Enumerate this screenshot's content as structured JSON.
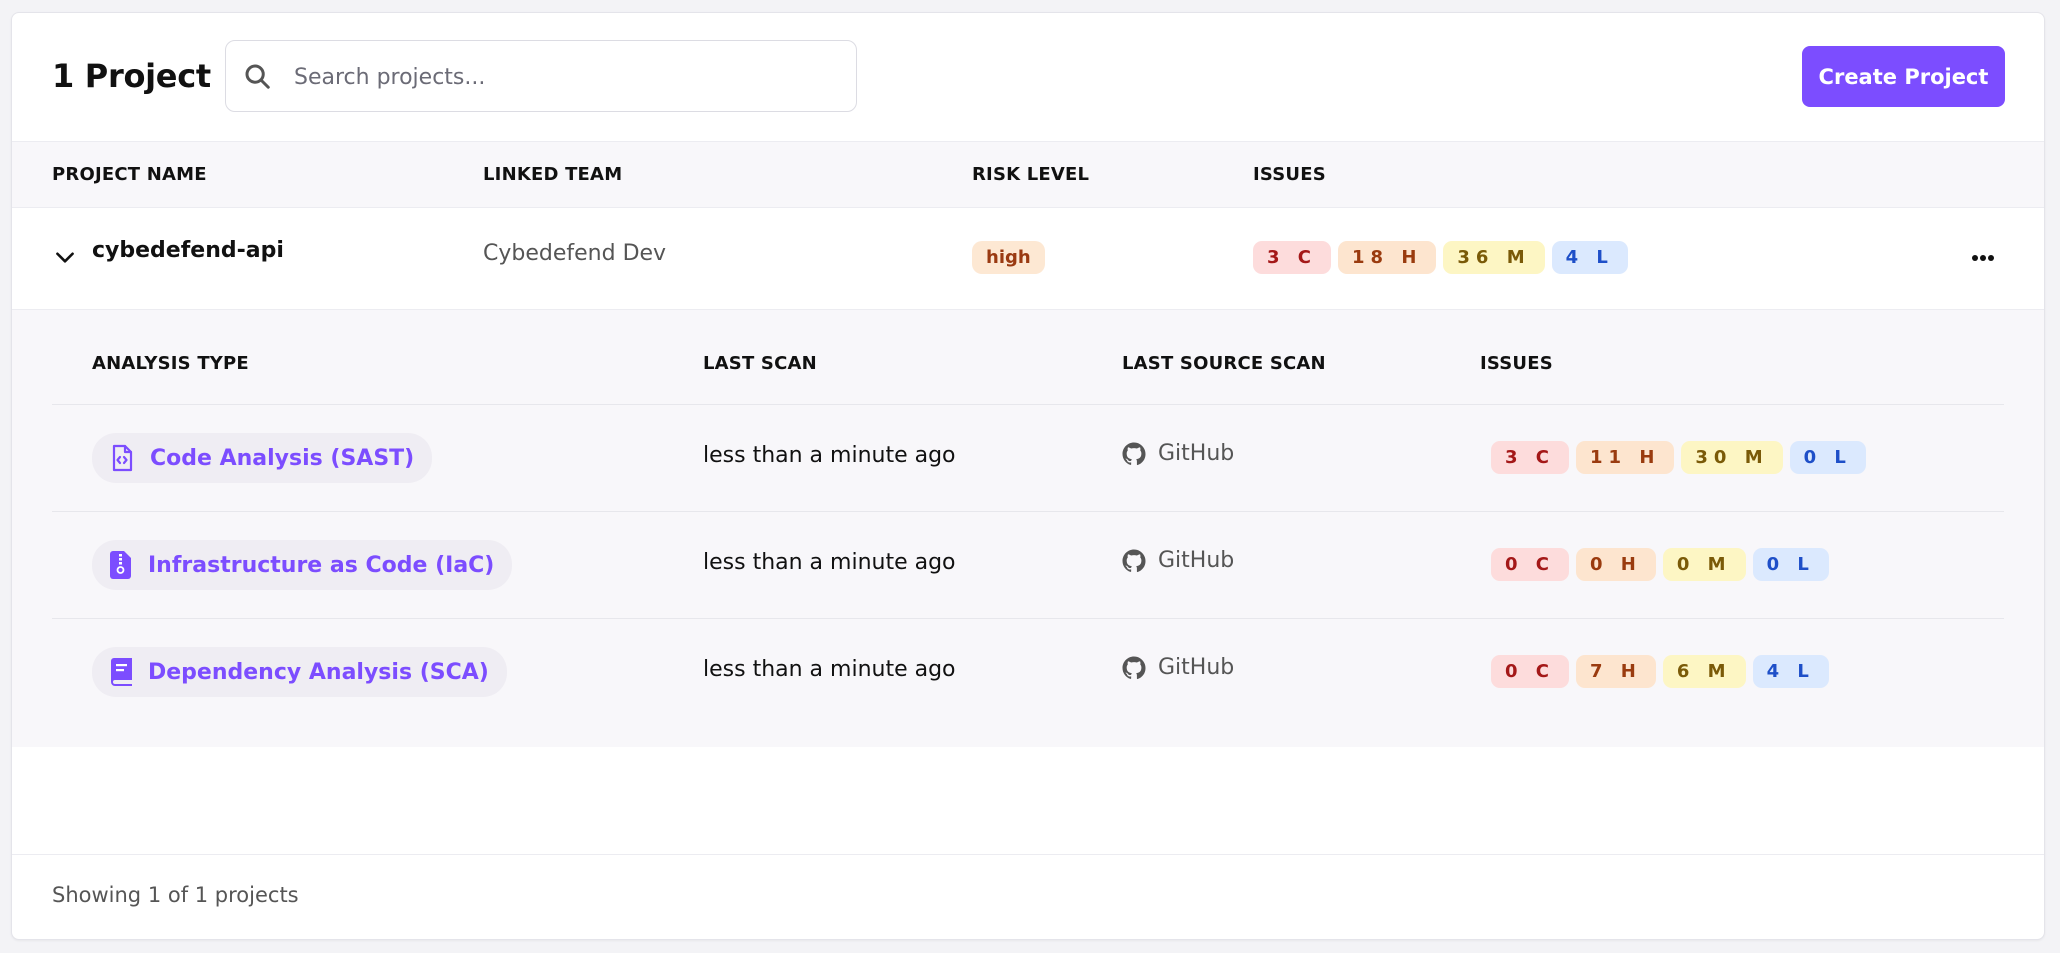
{
  "header": {
    "title": "1 Project",
    "search_placeholder": "Search projects...",
    "create_label": "Create Project"
  },
  "table": {
    "columns": [
      "PROJECT NAME",
      "LINKED TEAM",
      "RISK LEVEL",
      "ISSUES"
    ]
  },
  "project": {
    "name": "cybedefend-api",
    "team": "Cybedefend Dev",
    "risk": "high",
    "issues": [
      "3 C",
      "18 H",
      "36 M",
      "4 L"
    ]
  },
  "analysis": {
    "columns": [
      "ANALYSIS TYPE",
      "LAST SCAN",
      "LAST SOURCE SCAN",
      "ISSUES"
    ],
    "rows": [
      {
        "type": "Code Analysis (SAST)",
        "icon": "code-file-icon",
        "last_scan": "less than a minute ago",
        "source": "GitHub",
        "issues": [
          "3 C",
          "11 H",
          "30 M",
          "0 L"
        ]
      },
      {
        "type": "Infrastructure as Code (IaC)",
        "icon": "zip-file-icon",
        "last_scan": "less than a minute ago",
        "source": "GitHub",
        "issues": [
          "0 C",
          "0 H",
          "0 M",
          "0 L"
        ]
      },
      {
        "type": "Dependency Analysis (SCA)",
        "icon": "book-icon",
        "last_scan": "less than a minute ago",
        "source": "GitHub",
        "issues": [
          "0 C",
          "7 H",
          "6 M",
          "4 L"
        ]
      }
    ]
  },
  "footer": {
    "text": "Showing 1 of 1 projects"
  },
  "colors": {
    "accent": "#7c4dff",
    "critical_bg": "#fddcdc",
    "critical_fg": "#a41818",
    "high_bg": "#fde5cf",
    "high_fg": "#9a3b0f",
    "medium_bg": "#fdf6c4",
    "medium_fg": "#7a5a08",
    "low_bg": "#dbe9fe",
    "low_fg": "#1e4fc8"
  }
}
